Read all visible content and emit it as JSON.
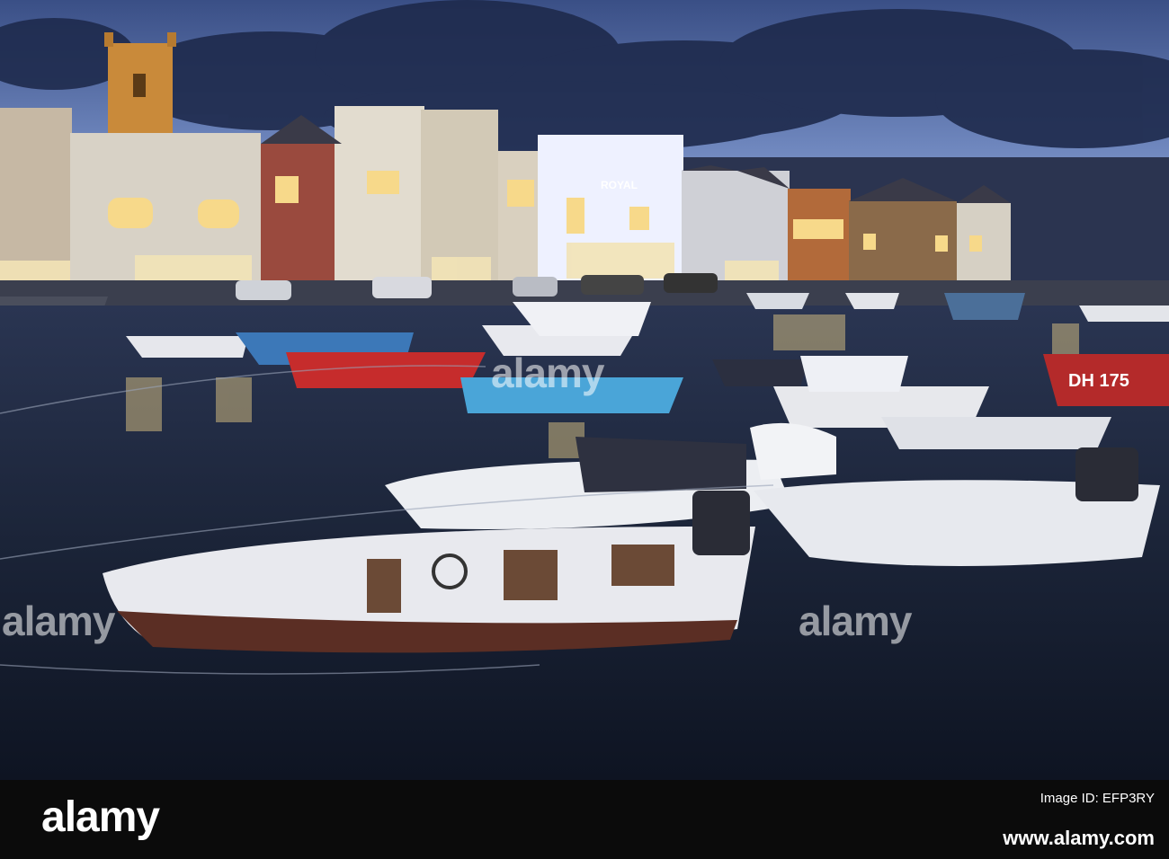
{
  "photo": {
    "boat_registration": "DH 175",
    "hotel_sign": "ROYAL"
  },
  "watermark": {
    "left": "alamy",
    "center": "alamy",
    "right": "alamy"
  },
  "footer": {
    "logo": "alamy",
    "image_id_line1": "Image ID: EFP3RY",
    "url": "www.alamy.com"
  },
  "colors": {
    "sky_top": "#2a3a63",
    "sky_mid": "#5f7ab3",
    "water": "#1f2a40",
    "window_glow": "#f7d98a",
    "footer_bg": "#0b0b0b"
  }
}
